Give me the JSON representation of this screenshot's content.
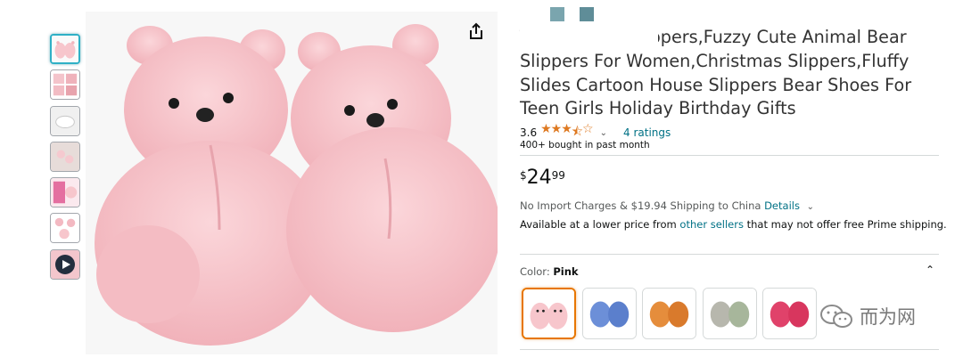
{
  "product": {
    "title": "Teddy Bears Slippers,Fuzzy Cute Animal Bear Slippers For Women,Christmas Slippers,Fluffy Slides Cartoon House Slippers Bear Shoes For Teen Girls Holiday Birthday Gifts",
    "rating_value": "3.6",
    "stars": 3.6,
    "ratings_count": "4 ratings",
    "bought": "400+ bought in past month"
  },
  "price": {
    "symbol": "$",
    "whole": "24",
    "fraction": "99"
  },
  "shipping": {
    "import_text": "No Import Charges & $19.94 Shipping to China",
    "details_link": "Details",
    "available_prefix": "Available at a lower price from",
    "other_sellers_link": "other sellers",
    "available_suffix": "that may not offer free Prime shipping."
  },
  "color": {
    "label": "Color:",
    "selected": "Pink",
    "options": [
      "pink",
      "blue",
      "orange",
      "grey",
      "red"
    ]
  },
  "watermark": {
    "text": "而为网"
  },
  "colors": {
    "star": "#de7921",
    "link": "#007185",
    "selected_swatch": "#e77600",
    "thumb_active": "#2fb0c6",
    "bear_pink": "#f7c6cc"
  },
  "icons": [
    "share-icon",
    "chevron-down-icon",
    "chevron-up-icon",
    "play-icon",
    "wechat-icon"
  ]
}
